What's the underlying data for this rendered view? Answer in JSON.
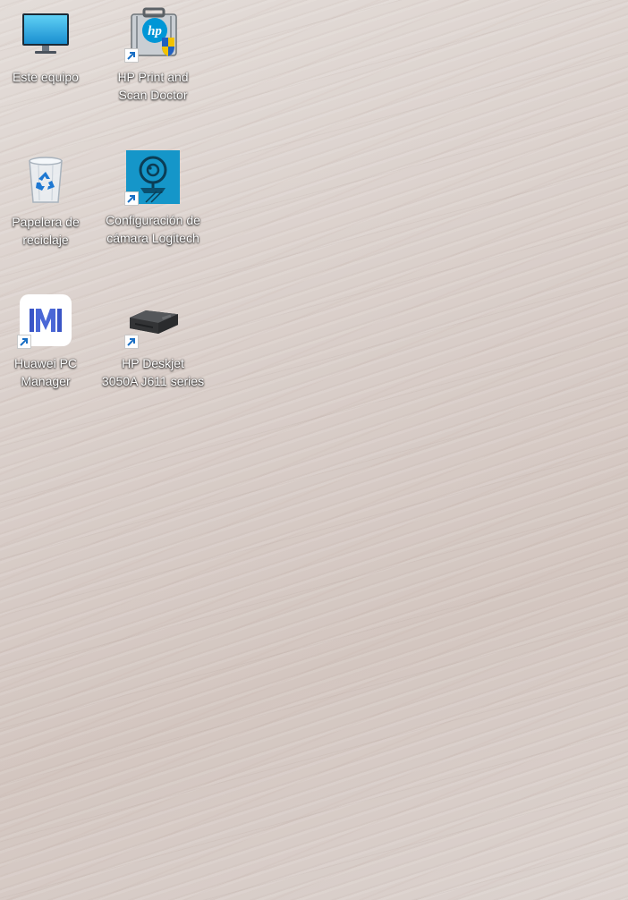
{
  "desktop": {
    "icons": [
      {
        "label": "Este equipo",
        "icon": "monitor-icon",
        "shortcut": false
      },
      {
        "label": "HP Print and\nScan Doctor",
        "icon": "hp-toolbox-icon",
        "shortcut": true
      },
      {
        "label": "Papelera de\nreciclaje",
        "icon": "recycle-bin-icon",
        "shortcut": false
      },
      {
        "label": "Configuración de\ncámara Logitech",
        "icon": "logitech-camera-icon",
        "shortcut": true
      },
      {
        "label": "Huawei PC\nManager",
        "icon": "huawei-pc-manager-icon",
        "shortcut": true
      },
      {
        "label": "HP Deskjet\n3050A J611 series",
        "icon": "printer-icon",
        "shortcut": true
      }
    ]
  },
  "colors": {
    "wallpaper": "#d9cfca",
    "label_text": "#ffffff",
    "hp_blue": "#0096d6",
    "logitech_blue": "#1596c9",
    "huawei_blue": "#3a55c6"
  }
}
